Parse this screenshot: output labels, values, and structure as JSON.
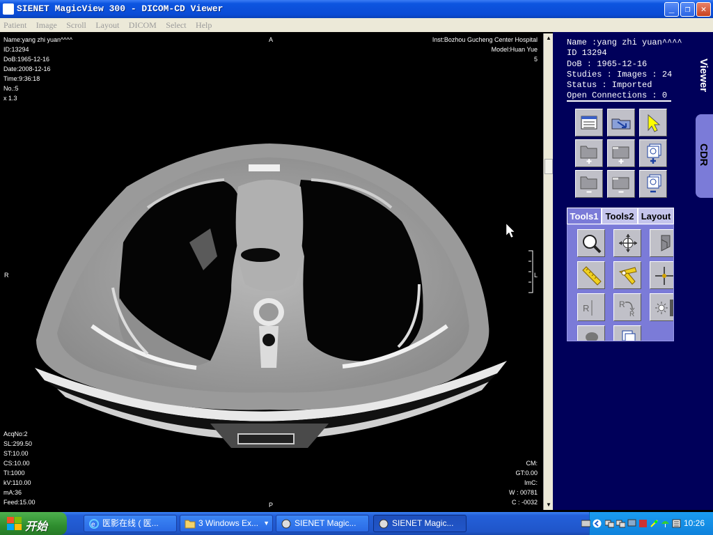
{
  "window": {
    "title": "SIENET MagicView 300  - DICOM-CD Viewer",
    "buttons": {
      "minimize": "_",
      "maximize": "❐",
      "close": "✕"
    }
  },
  "menu": [
    "Patient",
    "Image",
    "Scroll",
    "Layout",
    "DICOM",
    "Select",
    "Help"
  ],
  "viewer": {
    "top_left": [
      "Name:yang zhi yuan^^^^",
      "ID:13294",
      "DoB:1965-12-16",
      "Date:2008-12-16",
      "Time:9:36:18",
      "No.:5",
      "x 1.3"
    ],
    "top_right": [
      "Inst:Bozhou Gucheng Center Hospital",
      "Model:Huan Yue",
      "5"
    ],
    "bottom_left": [
      "AcqNo:2",
      "SL:299.50",
      "ST:10.00",
      "CS:10.00",
      "TI:1000",
      "kV:110.00",
      "mA:36",
      "Feed:15.00"
    ],
    "bottom_right": [
      "CM:",
      "GT:0.00",
      "ImC:",
      "W : 00781",
      "C : -0032"
    ],
    "orientation": {
      "top": "A",
      "bottom": "P",
      "left": "R",
      "right": "L"
    }
  },
  "patient_info": {
    "name": "Name :yang zhi yuan^^^^",
    "id": "ID 13294",
    "dob": "DoB : 1965-12-16",
    "studies": "Studies : Images : 24",
    "status": "Status : Imported",
    "connections": "Open Connections : 0"
  },
  "tool_tabs": [
    "Tools1",
    "Tools2",
    "Layout"
  ],
  "side_tabs": {
    "viewer": "Viewer",
    "cdr": "CDR"
  },
  "taskbar": {
    "start_label": "开始",
    "tasks": [
      "医影在线 ( 医...",
      "3 Windows Ex...",
      "SIENET Magic...",
      "SIENET Magic..."
    ],
    "clock": "10:26"
  },
  "colors": {
    "panel_bg": "#00005a",
    "tool_bg": "#7b7bd8",
    "titlebar": "#0a4bd6"
  }
}
